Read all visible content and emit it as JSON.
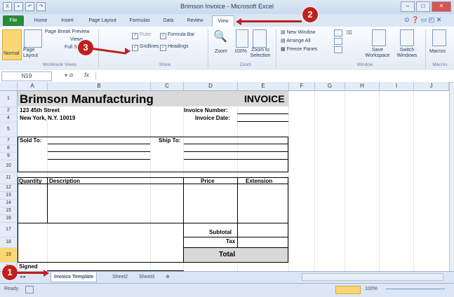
{
  "window": {
    "title": "Brimson Invoice - Microsoft Excel",
    "controls": {
      "minimize": "–",
      "maximize": "□",
      "close": "✕"
    }
  },
  "tabs": [
    "File",
    "Home",
    "Insert",
    "Page Layout",
    "Formulas",
    "Data",
    "Review",
    "View"
  ],
  "active_tab": "View",
  "ribbon": {
    "workbook_views": {
      "normal": "Normal",
      "page_layout": "Page Layout",
      "page_break_preview": "Page Break Preview",
      "custom_views": "Views",
      "full_screen": "Full Screen",
      "group_label": "Workbook Views"
    },
    "show": {
      "ruler": "Ruler",
      "formula_bar": "Formula Bar",
      "gridlines": "Gridlines",
      "headings": "Headings",
      "group_label": "Show"
    },
    "zoom": {
      "zoom": "Zoom",
      "hundred": "100%",
      "zoom_selection": "Zoom to Selection",
      "group_label": "Zoom"
    },
    "window": {
      "new_window": "New Window",
      "arrange_all": "Arrange All",
      "freeze_panes": "Freeze Panes",
      "save_workspace": "Save Workspace",
      "switch_windows": "Switch Windows",
      "group_label": "Window"
    },
    "macros": {
      "macros": "Macros",
      "group_label": "Macros"
    }
  },
  "formula_bar": {
    "name_box": "N19",
    "fx": "fx",
    "value": ""
  },
  "columns": [
    "A",
    "B",
    "C",
    "D",
    "E",
    "F",
    "G",
    "H",
    "I",
    "J"
  ],
  "rows": [
    "1",
    "2",
    "4",
    "5",
    "7",
    "8",
    "9",
    "10",
    "11",
    "12",
    "13",
    "14",
    "15",
    "16",
    "17",
    "18",
    "19",
    "20"
  ],
  "invoice": {
    "company": "Brimson Manufacturing",
    "heading": "INVOICE",
    "street": "123 45th Street",
    "city": "New York, N.Y. 10019",
    "invoice_number_label": "Invoice Number:",
    "invoice_date_label": "Invoice Date:",
    "sold_to": "Sold To:",
    "ship_to": "Ship To:",
    "quantity": "Quantity",
    "description": "Description",
    "price": "Price",
    "extension": "Extension",
    "subtotal": "Subtotal",
    "tax": "Tax",
    "total": "Total",
    "signed": "Signed"
  },
  "sheet_tabs": [
    "Invoice Template",
    "Sheet2",
    "Sheet3"
  ],
  "active_sheet": "Invoice Template",
  "status": {
    "ready": "Ready",
    "zoom": "100%"
  },
  "callouts": {
    "one": "1",
    "two": "2",
    "three": "3"
  },
  "colors": {
    "callout": "#c0201c",
    "file_tab": "#2a8a3a"
  }
}
